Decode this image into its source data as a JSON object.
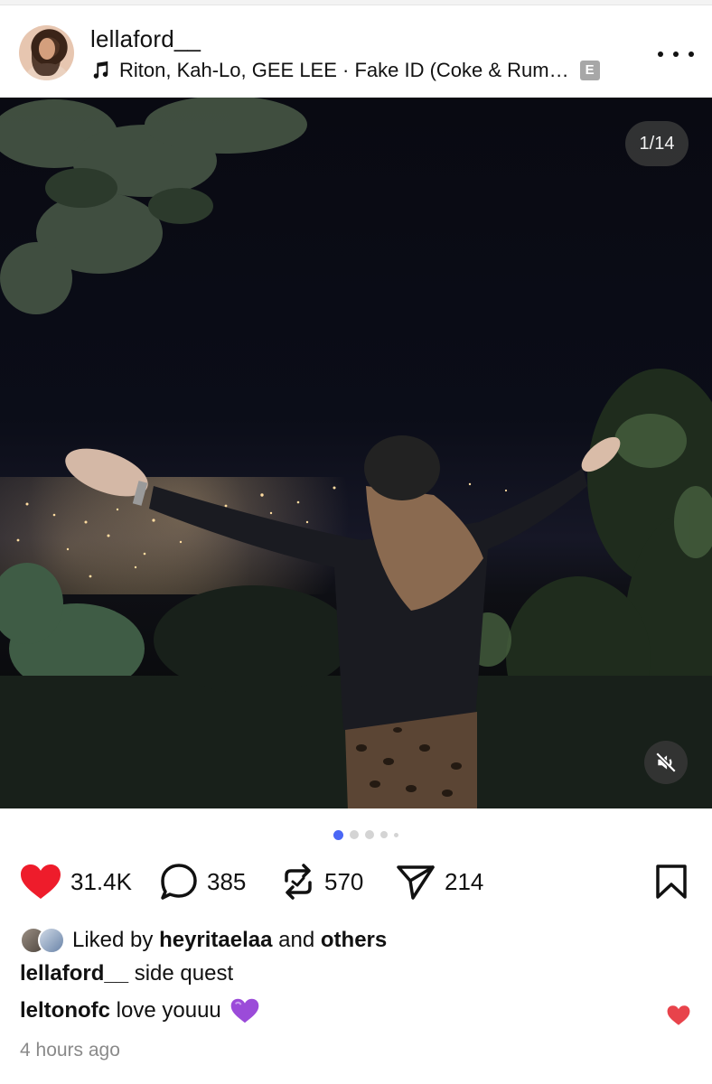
{
  "header": {
    "username": "lellaford__",
    "music": "Riton, Kah-Lo, GEE LEE · Fake ID (Coke & Rum…",
    "explicit_badge": "E",
    "more_icon": "more-horizontal-icon"
  },
  "photo": {
    "counter": "1/14",
    "mute_icon": "volume-muted-icon"
  },
  "pager": {
    "count": 5,
    "active_index": 0,
    "active_color": "#4a67f5"
  },
  "actions": {
    "likes": "31.4K",
    "comments": "385",
    "reposts": "570",
    "shares": "214",
    "like_color": "#ee1c2b"
  },
  "liked_by": {
    "prefix": "Liked by",
    "user": "heyritaelaa",
    "joiner": "and",
    "others": "others"
  },
  "caption": {
    "user": "lellaford__",
    "text": "side quest"
  },
  "comment": {
    "user": "leltonofc",
    "text": "love youuu",
    "emoji": "purple-heart-icon",
    "like_color": "#e8434b"
  },
  "timestamp": "4 hours ago"
}
